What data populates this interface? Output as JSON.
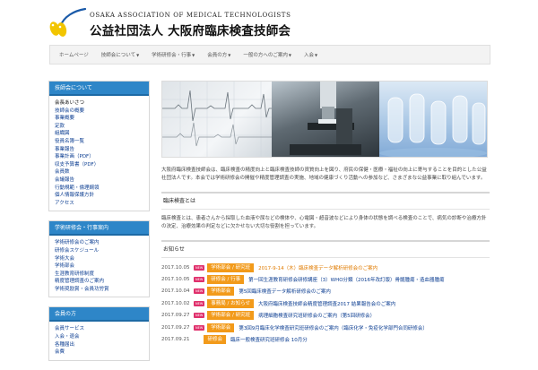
{
  "header": {
    "org_en": "OSAKA ASSOCIATION OF MEDICAL TECHNOLOGISTS",
    "org_jp": "公益社団法人 大阪府臨床検査技師会"
  },
  "nav": {
    "items": [
      {
        "label": "ホームページ",
        "dropdown": false
      },
      {
        "label": "技師会について",
        "dropdown": true
      },
      {
        "label": "学術研修会・行事",
        "dropdown": true
      },
      {
        "label": "会員の方",
        "dropdown": true
      },
      {
        "label": "一般の方へのご案内",
        "dropdown": true
      },
      {
        "label": "入会",
        "dropdown": true
      }
    ]
  },
  "sidebar": {
    "w1": {
      "title": "技師会について",
      "items": [
        "会長あいさつ",
        "技師会の概要",
        "事業概要",
        "定款",
        "組織図",
        "役員名簿一覧",
        "事業報告",
        "事業計画（PDF）",
        "収支予算書（PDF）",
        "会員数",
        "会議報告",
        "行動規範・倫理綱領",
        "個人情報保護方針",
        "アクセス"
      ]
    },
    "w2": {
      "title": "学術研修会・行事案内",
      "items": [
        "学術研修会のご案内",
        "研修会スケジュール",
        "学術大会",
        "学術部会",
        "生涯教育研修制度",
        "精度管理調査のご案内",
        "学術奨励賞・会員功労賞"
      ]
    },
    "w3": {
      "title": "会員の方",
      "items": [
        "会員サービス",
        "入会・退会",
        "各種届出",
        "会費"
      ]
    }
  },
  "main": {
    "intro": "大阪府臨床検査技師会は、臨床検査の精度向上と臨床検査技師の資質向上を図り、府民の保健・医療・福祉の向上に寄与することを目的とした公益社団法人です。本会では学術研修会の開催や精度管理調査の実施、地域の健康づくり活動への参加など、さまざまな公益事業に取り組んでいます。",
    "about_title": "臨床検査とは",
    "about_body": "臨床検査とは、患者さんから採取した血液や尿などの検体や、心電図・超音波などにより身体の状態を調べる検査のことで、病気の診断や治療方針の決定、治療効果の判定などに欠かせない大切な役割を担っています。",
    "news_title": "お知らせ",
    "news": [
      {
        "date": "2017.10.05",
        "new_label": "NEW",
        "category": "学術部会 / 研究班",
        "text": "2017-9-14（木）臨床検査データ解析研修会のご案内",
        "text_color": "orange"
      },
      {
        "date": "2017.10.05",
        "new_label": "NEW",
        "category": "研修会 / 行事",
        "text": "第一回生涯教育研修会研修講座（3）WHO分類（2016年改訂版）骨髄腫瘍・造血器腫瘍",
        "text_color": "blue"
      },
      {
        "date": "2017.10.04",
        "new_label": "NEW",
        "category": "学術部会",
        "text": "第5回臨床検査データ解析研修会のご案内",
        "text_color": "blue"
      },
      {
        "date": "2017.10.02",
        "new_label": "NEW",
        "category": "事務局 / お知らせ",
        "text": "大阪府臨床検査技師会精度管理調査2017 結果報告会のご案内",
        "text_color": "blue"
      },
      {
        "date": "2017.09.27",
        "new_label": "NEW",
        "category": "学術部会 / 研究班",
        "text": "病理細胞検査研究班研修会のご案内（第5回研修会）",
        "text_color": "blue"
      },
      {
        "date": "2017.09.27",
        "new_label": "NEW",
        "category": "学術部会",
        "text": "第3回9月臨床化学検査研究班研修会のご案内（臨床化学・免疫化学部門合同研修会）",
        "text_color": "blue"
      },
      {
        "date": "2017.09.21",
        "new_label": "",
        "category": "研修会",
        "text": "臨床一般検査研究班研修会 10月分",
        "text_color": "blue"
      }
    ]
  },
  "colors": {
    "accent_blue": "#2e86c8",
    "badge_orange": "#f29a1a",
    "new_pink": "#e0306c",
    "link_blue": "#0b3d91"
  }
}
